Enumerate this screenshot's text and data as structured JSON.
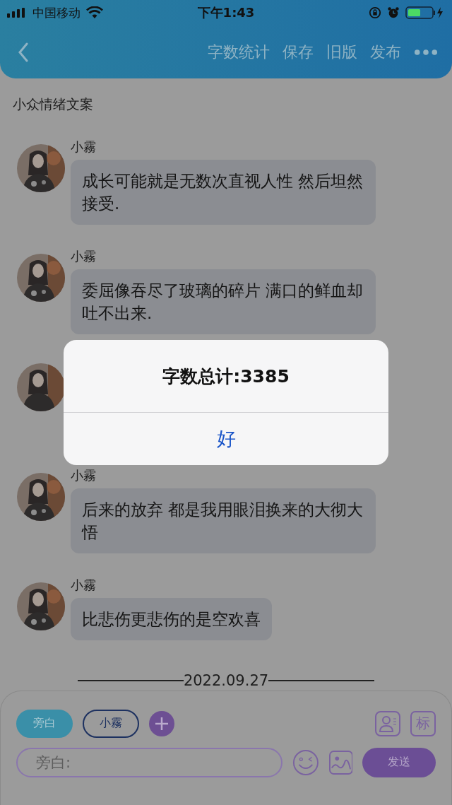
{
  "status_bar": {
    "carrier": "中国移动",
    "time": "下午1:43"
  },
  "nav": {
    "actions": [
      "字数统计",
      "保存",
      "旧版",
      "发布"
    ]
  },
  "title": "小众情绪文案",
  "messages": [
    {
      "kind": "message",
      "name": "小霧",
      "text": "成长可能就是无数次直视人性 然后坦然接受."
    },
    {
      "kind": "message",
      "name": "小霧",
      "text": "委屈像吞尽了玻璃的碎片 满口的鲜血却吐不出来."
    },
    {
      "kind": "covered"
    },
    {
      "kind": "message",
      "name": "小霧",
      "text": "后来的放弃 都是我用眼泪换来的大彻大悟"
    },
    {
      "kind": "message",
      "name": "小霧",
      "text": "比悲伤更悲伤的是空欢喜"
    }
  ],
  "date": "2022.09.27",
  "composer": {
    "roles": [
      {
        "label": "旁白",
        "selected": true
      },
      {
        "label": "小霧",
        "selected": false
      }
    ],
    "tag_button": "标",
    "placeholder": "旁白:",
    "send": "发送"
  },
  "dialog": {
    "message": "字数总计:3385",
    "button": "好"
  }
}
